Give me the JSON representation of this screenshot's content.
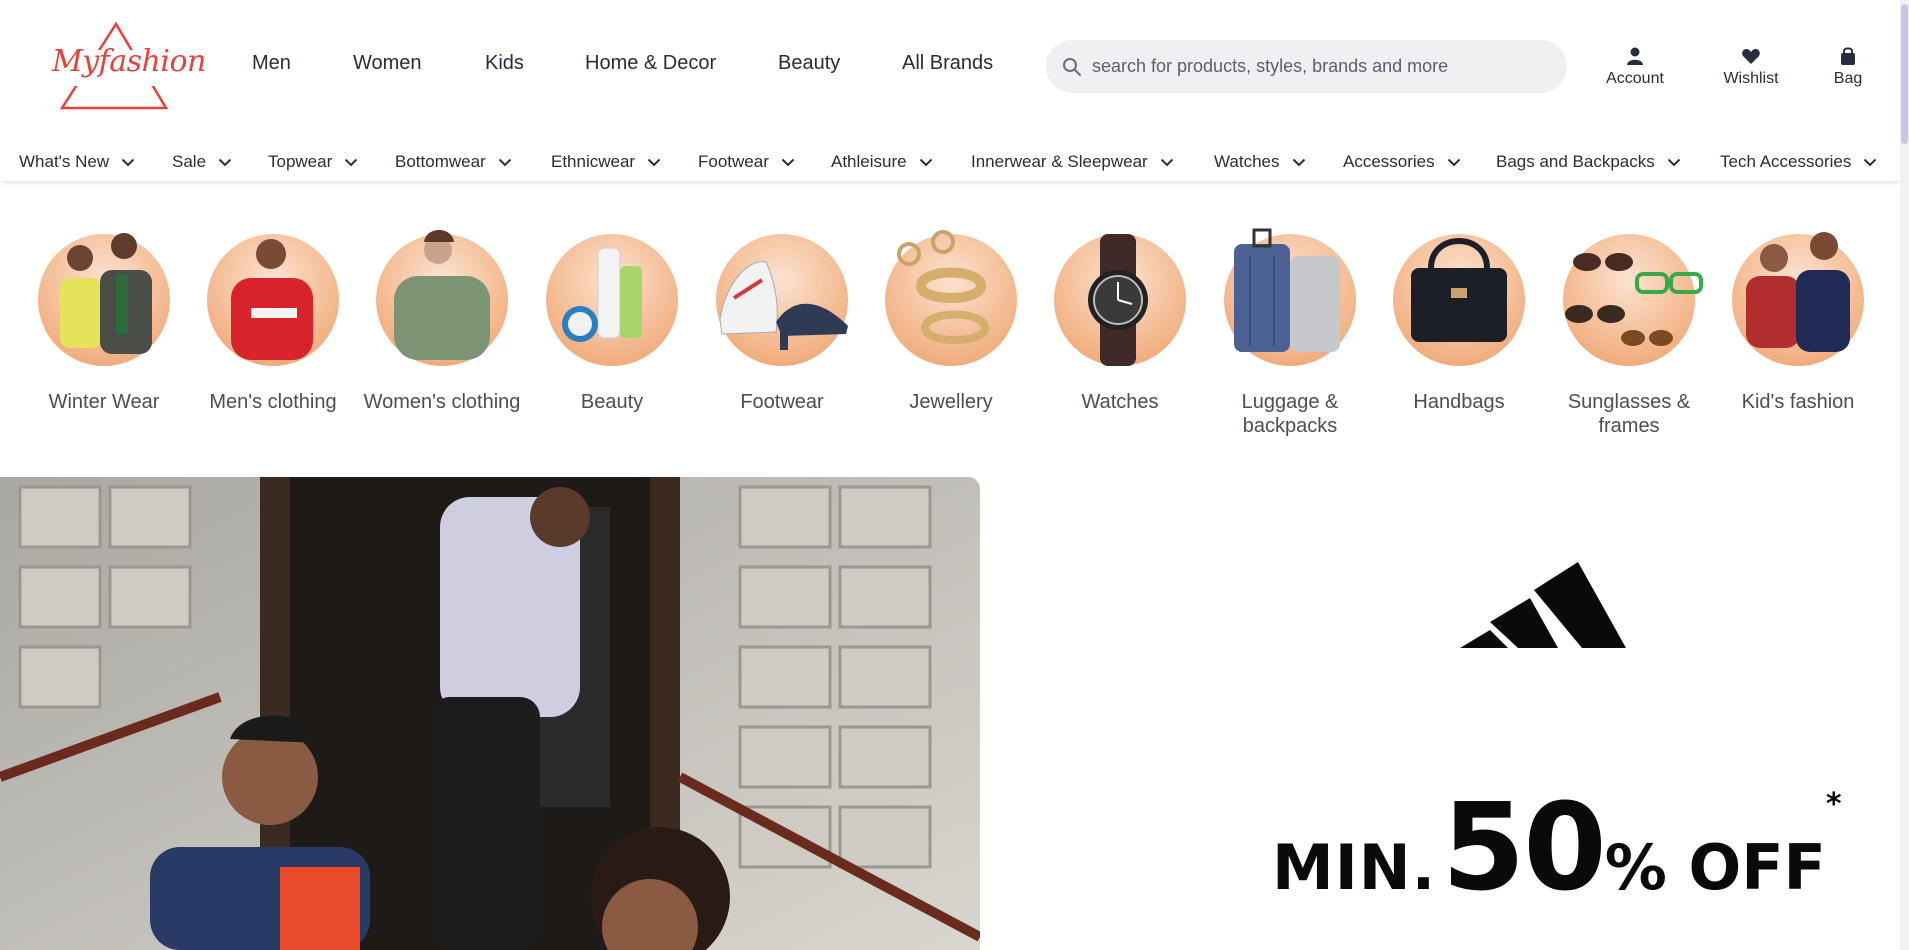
{
  "header": {
    "logo_text": "Myfashion",
    "nav": [
      "Men",
      "Women",
      "Kids",
      "Home & Decor",
      "Beauty",
      "All Brands"
    ],
    "search_placeholder": "search for products, styles, brands and more",
    "actions": [
      {
        "label": "Account",
        "icon": "user-icon"
      },
      {
        "label": "Wishlist",
        "icon": "heart-icon"
      },
      {
        "label": "Bag",
        "icon": "bag-icon"
      }
    ]
  },
  "catbar": {
    "items": [
      "What's New",
      "Sale",
      "Topwear",
      "Bottomwear",
      "Ethnicwear",
      "Footwear",
      "Athleisure",
      "Innerwear & Sleepwear",
      "Watches",
      "Accessories",
      "Bags and Backpacks",
      "Tech Accessories"
    ]
  },
  "circles": {
    "items": [
      "Winter Wear",
      "Men's clothing",
      "Women's clothing",
      "Beauty",
      "Footwear",
      "Jewellery",
      "Watches",
      "Luggage & backpacks",
      "Handbags",
      "Sunglasses & frames",
      "Kid's fashion"
    ]
  },
  "promo": {
    "offer_min": "MIN.",
    "offer_num": "50",
    "offer_pct": "% OFF",
    "offer_star": "*"
  },
  "colors": {
    "logo_red": "#e8403a",
    "circle_peach": "#f4b98f",
    "text": "#282c3f"
  }
}
